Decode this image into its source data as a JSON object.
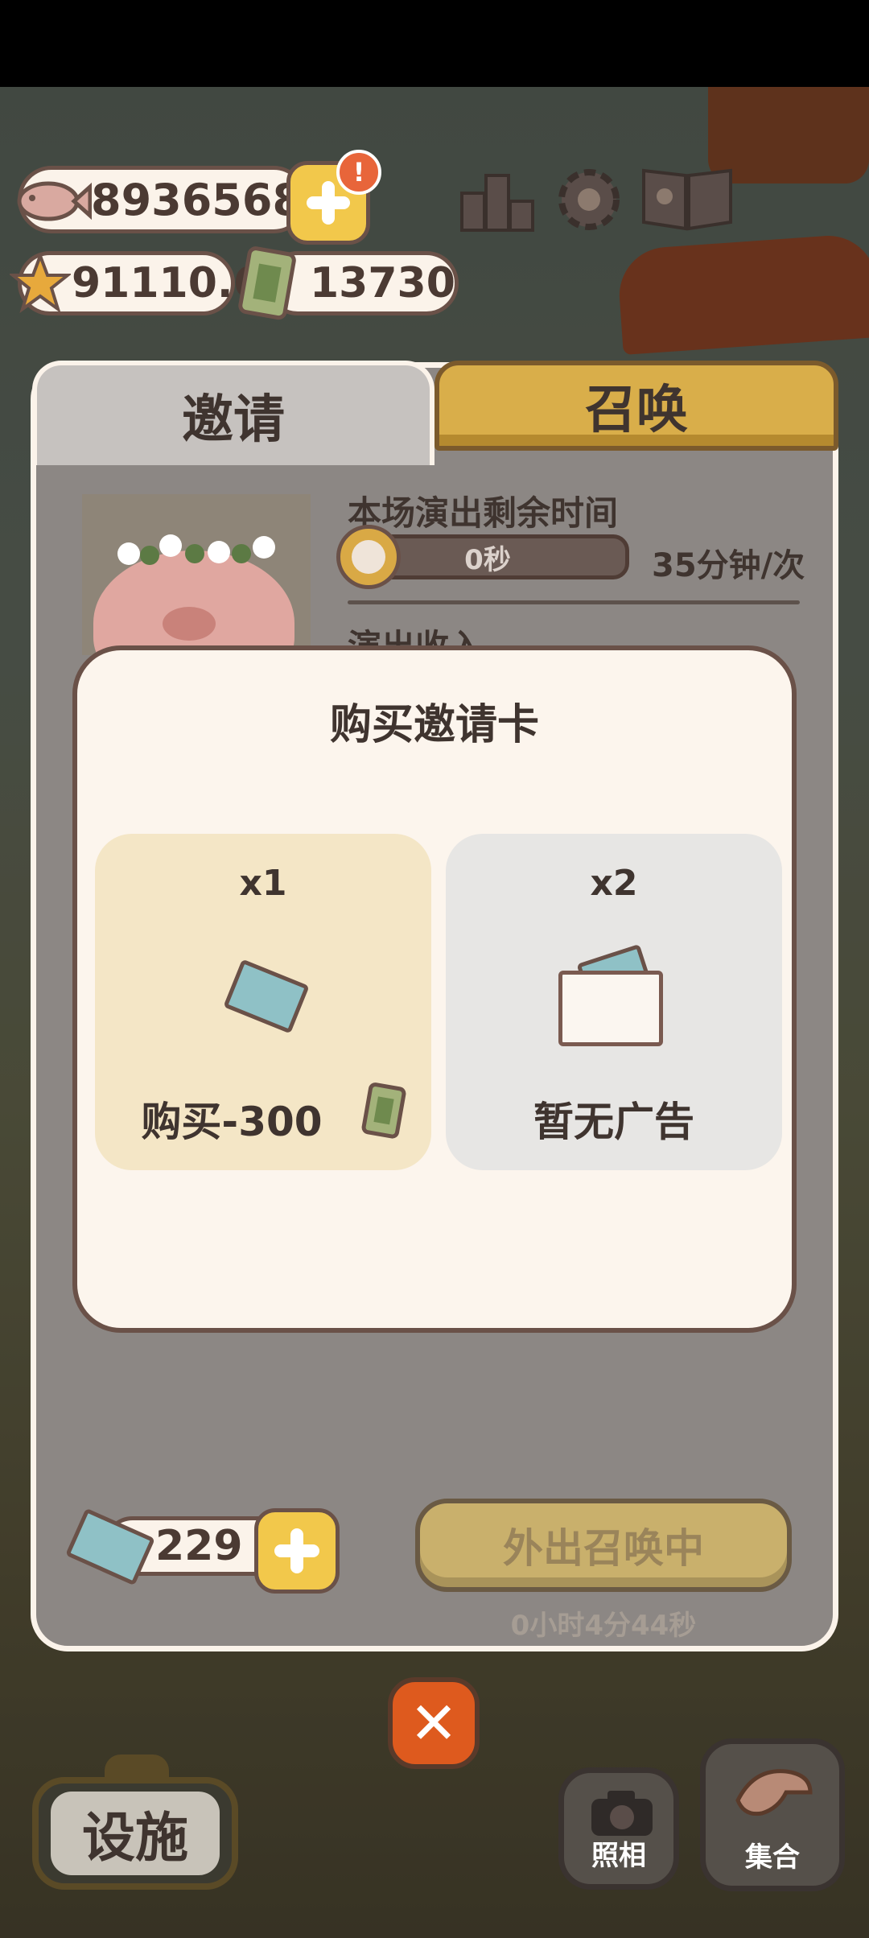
{
  "hud": {
    "fish_amount": "8936568",
    "alert_mark": "!",
    "star_amount": "91110.6",
    "ticket_amount": "13730"
  },
  "tabs": {
    "invite": "邀请",
    "summon": "召唤"
  },
  "performance": {
    "remaining_label": "本场演出剩余时间",
    "timer_value": "0秒",
    "per_label": "35分钟/次",
    "income_label": "演出收入"
  },
  "modal": {
    "title": "购买邀请卡",
    "option1": {
      "quantity": "x1",
      "action": "购买-300"
    },
    "option2": {
      "quantity": "x2",
      "action": "暂无广告"
    }
  },
  "panel_bottom": {
    "card_count": "229",
    "summon_button": "外出召唤中",
    "countdown": "0小时4分44秒"
  },
  "nav": {
    "close": "✕",
    "facility": "设施",
    "camera": "照相",
    "gather": "集合"
  },
  "colors": {
    "accent_yellow": "#f2c84b",
    "close_orange": "#de5a1e",
    "cream": "#fcf5ed",
    "outline_brown": "#6a5148"
  },
  "icons": [
    "fish-icon",
    "plus-icon",
    "alert-icon",
    "ranking-icon",
    "gear-icon",
    "book-icon",
    "star-icon",
    "ticket-icon",
    "clock-icon",
    "invite-card-icon",
    "envelope-icon",
    "close-icon",
    "camera-icon",
    "whistle-icon"
  ]
}
